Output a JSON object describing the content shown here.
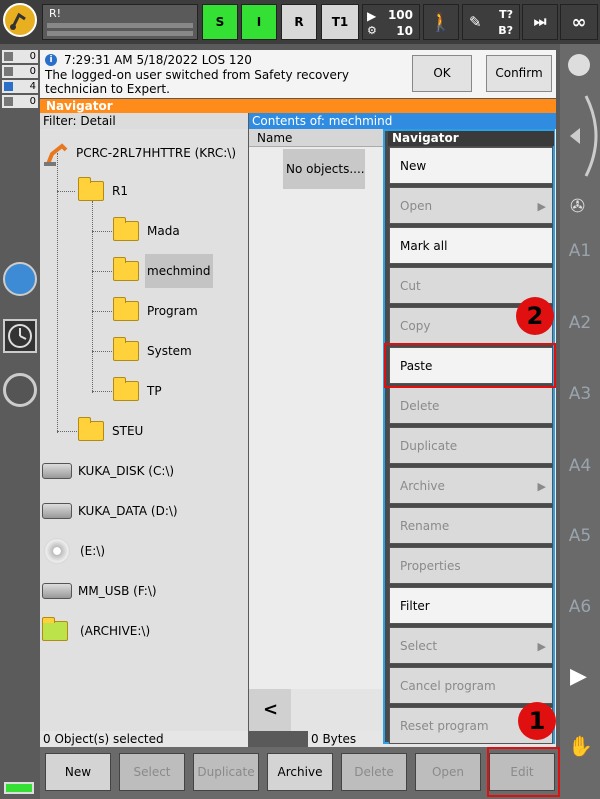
{
  "topbar": {
    "robot_label": "R!",
    "mode_buttons": [
      "S",
      "I",
      "R",
      "T1"
    ],
    "override": "100",
    "jog_override": "10",
    "t_label": "T?",
    "b_label": "B?",
    "infinity": "∞"
  },
  "counters": [
    "0",
    "0",
    "4",
    "0"
  ],
  "message": {
    "text": "7:29:31 AM 5/18/2022 LOS 120",
    "detail": "The logged-on user switched from Safety recovery technician to Expert.",
    "ok_label": "OK",
    "confirm_all_label": "Confirm all"
  },
  "navigator": {
    "title": "Navigator",
    "filter": "Filter: Detail",
    "tree": {
      "root": "PCRC-2RL7HHTTRE (KRC:\\)",
      "r1": "R1",
      "mada": "Mada",
      "mechmind": "mechmind",
      "program": "Program",
      "system": "System",
      "tp": "TP",
      "steu": "STEU",
      "kuka_disk": "KUKA_DISK (C:\\)",
      "kuka_data": "KUKA_DATA (D:\\)",
      "e_drive": "(E:\\)",
      "mm_usb": "MM_USB (F:\\)",
      "archive": "(ARCHIVE:\\)"
    },
    "contents_title": "Contents of: mechmind",
    "name_column": "Name",
    "no_objects": "No objects....",
    "scroll_left": "<",
    "status_selected": "0 Object(s) selected",
    "status_bytes": "0 Bytes"
  },
  "popup": {
    "title": "Navigator",
    "items": [
      {
        "label": "New",
        "enabled": true
      },
      {
        "label": "Open",
        "enabled": false,
        "arrow": "▶"
      },
      {
        "label": "Mark all",
        "enabled": true
      },
      {
        "label": "Cut",
        "enabled": false
      },
      {
        "label": "Copy",
        "enabled": false
      },
      {
        "label": "Paste",
        "enabled": true
      },
      {
        "label": "Delete",
        "enabled": false
      },
      {
        "label": "Duplicate",
        "enabled": false
      },
      {
        "label": "Archive",
        "enabled": false,
        "arrow": "▶"
      },
      {
        "label": "Rename",
        "enabled": false
      },
      {
        "label": "Properties",
        "enabled": false
      },
      {
        "label": "Filter",
        "enabled": true
      },
      {
        "label": "Select",
        "enabled": false,
        "arrow": "▶"
      },
      {
        "label": "Cancel program",
        "enabled": false
      },
      {
        "label": "Reset program",
        "enabled": false
      }
    ]
  },
  "axes": [
    "A1",
    "A2",
    "A3",
    "A4",
    "A5",
    "A6"
  ],
  "bottom_buttons": [
    {
      "label": "New",
      "enabled": true
    },
    {
      "label": "Select",
      "enabled": false
    },
    {
      "label": "Duplicate",
      "enabled": false
    },
    {
      "label": "Archive",
      "enabled": true
    },
    {
      "label": "Delete",
      "enabled": false
    },
    {
      "label": "Open",
      "enabled": false
    },
    {
      "label": "Edit",
      "enabled": false
    }
  ],
  "annotations": {
    "step1": "1",
    "step2": "2"
  },
  "colors": {
    "accent_orange": "#ff8c1a",
    "selection_blue": "#2aa0e8",
    "highlight_red": "#e01010",
    "status_green": "#33e033"
  }
}
